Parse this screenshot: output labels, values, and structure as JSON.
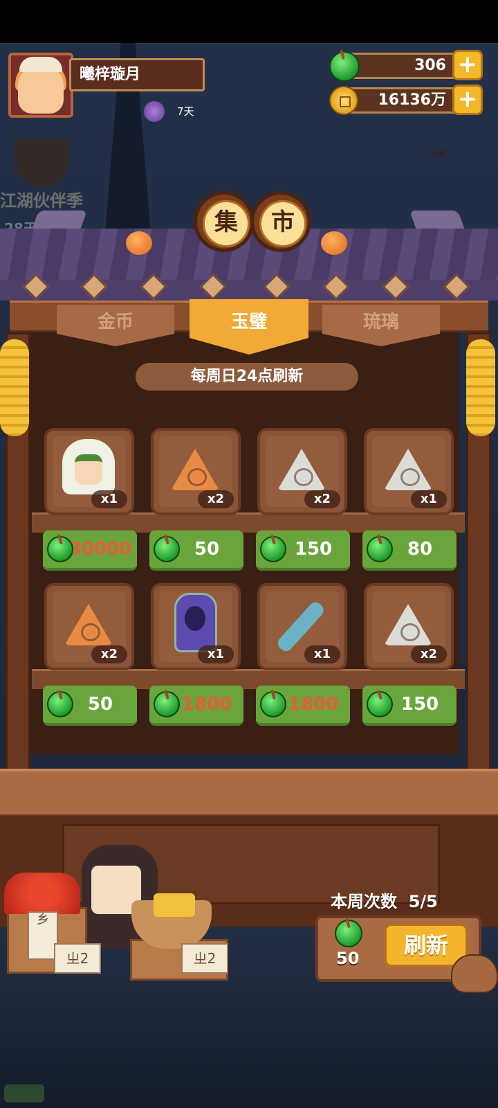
{
  "player": {
    "name": "曦梓璇月",
    "badge_days": "7天"
  },
  "currency": {
    "jade": "306",
    "gold": "16136万",
    "plus_label": "+"
  },
  "event": {
    "title": "江湖伙伴季",
    "days": "28天"
  },
  "shop": {
    "sign_chars": [
      "集",
      "市"
    ],
    "tabs": [
      {
        "label": "金币",
        "active": false
      },
      {
        "label": "玉璧",
        "active": true
      },
      {
        "label": "琉璃",
        "active": false
      }
    ],
    "refresh_note": "每周日24点刷新",
    "items": [
      {
        "icon": "hooded-companion-doll",
        "qty": "x1",
        "price": "30000",
        "price_color": "red"
      },
      {
        "icon": "orange-triangle-rune",
        "qty": "x2",
        "price": "50",
        "price_color": "white"
      },
      {
        "icon": "white-triangle-rune-beetle",
        "qty": "x2",
        "price": "150",
        "price_color": "white"
      },
      {
        "icon": "white-triangle-rune-flower",
        "qty": "x1",
        "price": "80",
        "price_color": "white"
      },
      {
        "icon": "orange-triangle-rune-glyph",
        "qty": "x2",
        "price": "50",
        "price_color": "white"
      },
      {
        "icon": "purple-lantern-spirit",
        "qty": "x1",
        "price": "1800",
        "price_color": "red"
      },
      {
        "icon": "painted-umbrella",
        "qty": "x1",
        "price": "1800",
        "price_color": "red"
      },
      {
        "icon": "white-triangle-rune-spiral",
        "qty": "x2",
        "price": "150",
        "price_color": "white"
      }
    ]
  },
  "stall": {
    "tag_left": "乡",
    "tag_price_1": "ㄓ2",
    "tag_price_2": "ㄓ2"
  },
  "refresh": {
    "week_label": "本周次数",
    "week_count": "5/5",
    "cost": "50",
    "button_label": "刷新"
  },
  "colors": {
    "price_green": "#6aa53c",
    "price_red_text": "#e85a3a",
    "active_tab": "#f2aa36",
    "button_gold": "#f4b52c"
  }
}
